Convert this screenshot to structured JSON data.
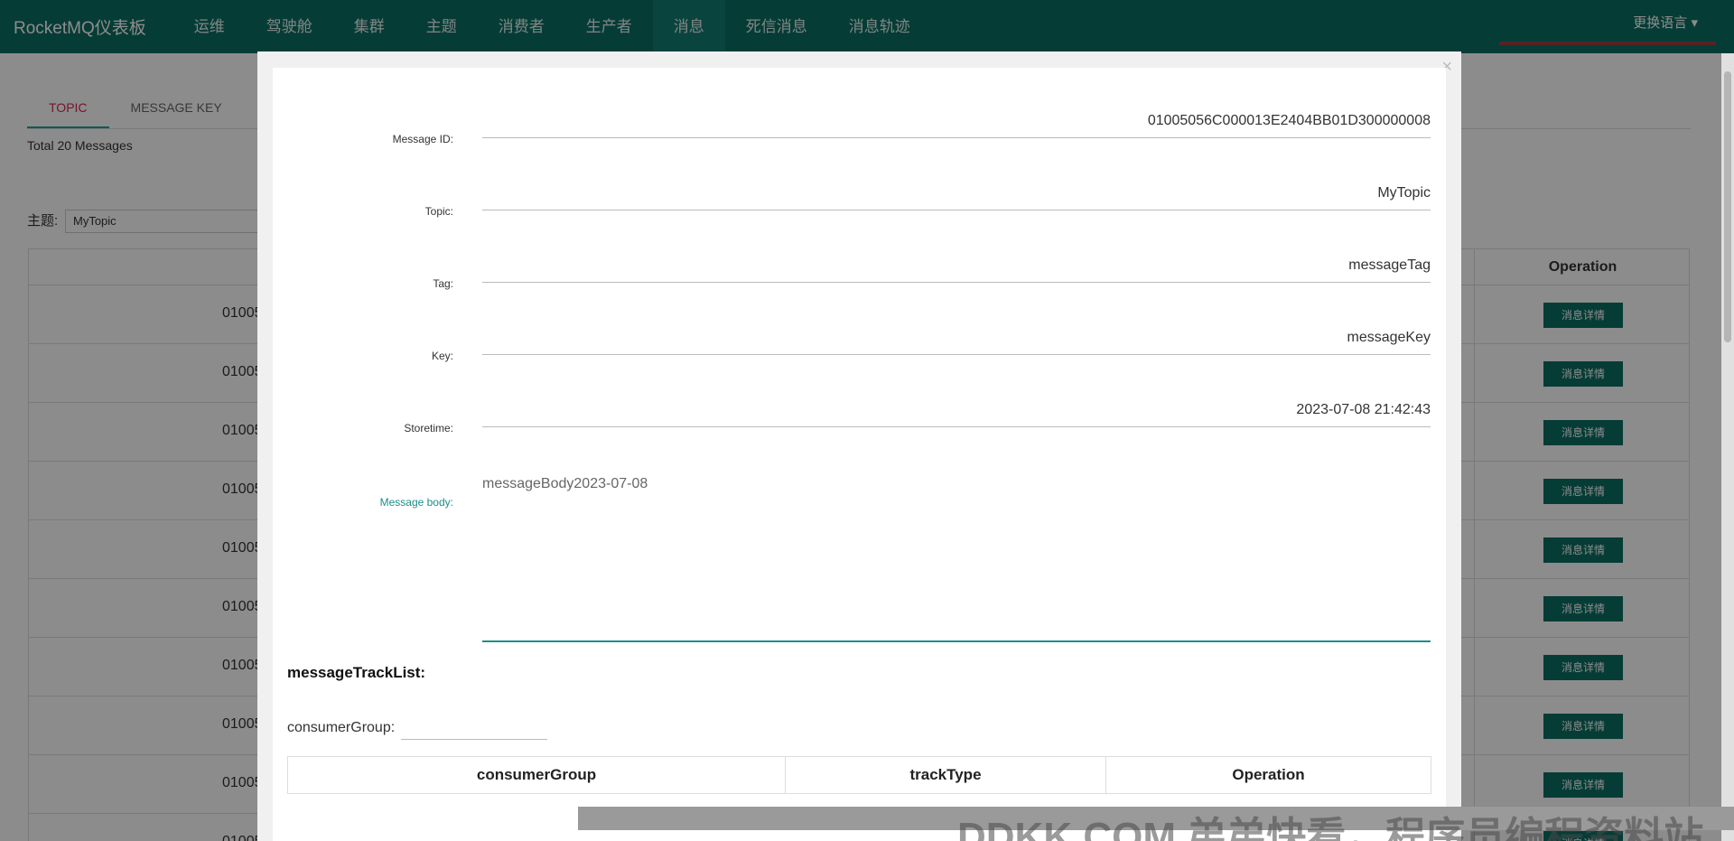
{
  "navbar": {
    "brand": "RocketMQ仪表板",
    "items": [
      "运维",
      "驾驶舱",
      "集群",
      "主题",
      "消费者",
      "生产者",
      "消息",
      "死信消息",
      "消息轨迹"
    ],
    "active": "消息",
    "user": "更换语言 ▾"
  },
  "page": {
    "tabs": [
      "TOPIC",
      "MESSAGE KEY"
    ],
    "total": "Total 20 Messages",
    "topic_label": "主题:",
    "topic_value": "MyTopic",
    "table_header_operation": "Operation",
    "row_id_prefix": "01005",
    "detail_button": "消息详情"
  },
  "modal": {
    "close": "×",
    "fields": {
      "message_id": {
        "label": "Message ID:",
        "value": "01005056C000013E2404BB01D300000008"
      },
      "topic": {
        "label": "Topic:",
        "value": "MyTopic"
      },
      "tag": {
        "label": "Tag:",
        "value": "messageTag"
      },
      "key": {
        "label": "Key:",
        "value": "messageKey"
      },
      "storetime": {
        "label": "Storetime:",
        "value": "2023-07-08 21:42:43"
      },
      "body": {
        "label": "Message body:",
        "value": "messageBody2023-07-08"
      }
    },
    "track_title": "messageTrackList:",
    "consumer_group_label": "consumerGroup:",
    "track_columns": [
      "consumerGroup",
      "trackType",
      "Operation"
    ]
  },
  "watermark": {
    "text": "DDKK.COM 弟弟快看，程序员编程资料站"
  },
  "colors": {
    "nav": "#0c6e63",
    "accent": "#1a8f8a",
    "tab_active": "#d22a4f"
  }
}
